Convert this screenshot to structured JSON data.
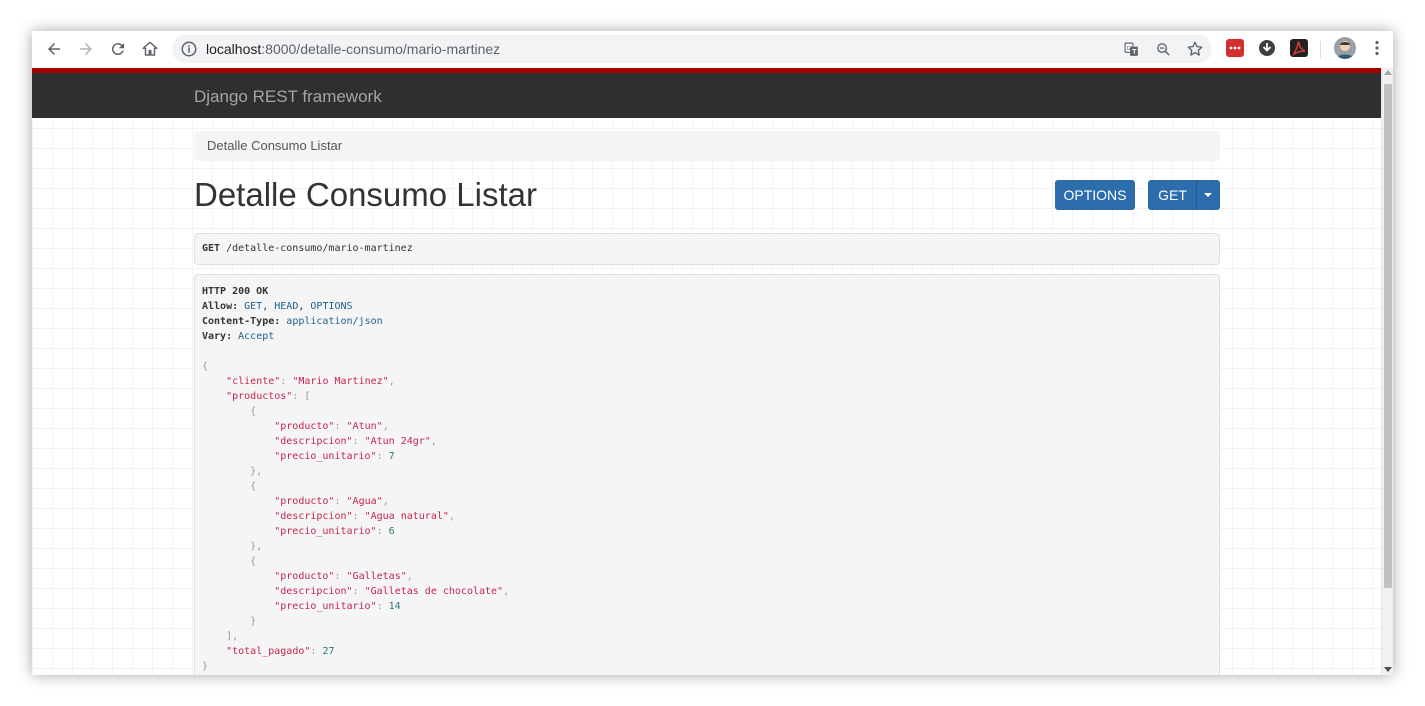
{
  "browser": {
    "url_host": "localhost",
    "url_rest": ":8000/detalle-consumo/mario-martinez"
  },
  "navbar": {
    "brand": "Django REST framework"
  },
  "breadcrumb": {
    "label": "Detalle Consumo Listar"
  },
  "page": {
    "title": "Detalle Consumo Listar"
  },
  "buttons": {
    "options": "OPTIONS",
    "get": "GET"
  },
  "request": {
    "method": "GET",
    "path": " /detalle-consumo/mario-martinez"
  },
  "response": {
    "status": "HTTP 200 OK",
    "allow_label": "Allow:",
    "allow_values": [
      " GET",
      ", ",
      "HEAD",
      ", ",
      "OPTIONS"
    ],
    "content_type_label": "Content-Type:",
    "content_type_value": " application/json",
    "vary_label": "Vary:",
    "vary_value": " Accept"
  },
  "json_body": {
    "cliente": "Mario Martinez",
    "productos": [
      {
        "producto": "Atun",
        "descripcion": "Atun 24gr",
        "precio_unitario": "7"
      },
      {
        "producto": "Agua",
        "descripcion": "Agua natural",
        "precio_unitario": "6"
      },
      {
        "producto": "Galletas",
        "descripcion": "Galletas de chocolate",
        "precio_unitario": "14"
      }
    ],
    "total_pagado": "27"
  },
  "json_keys": {
    "cliente": "\"cliente\"",
    "productos": "\"productos\"",
    "producto": "\"producto\"",
    "descripcion": "\"descripcion\"",
    "precio_unitario": "\"precio_unitario\"",
    "total_pagado": "\"total_pagado\""
  },
  "colors": {
    "navbar": "#2f2f2f",
    "navbar_accent": "#a30000",
    "button": "#2c6ead",
    "json_string": "#c7254e",
    "json_number": "#2b7a78",
    "meta_value": "#1f5f8f"
  },
  "icons": {
    "back": "back-arrow-icon",
    "forward": "forward-arrow-icon",
    "reload": "reload-icon",
    "home": "home-icon",
    "info": "info-icon",
    "translate": "translate-icon",
    "zoom": "zoom-icon",
    "bookmark": "star-icon",
    "extensions": [
      "lastpass-icon",
      "download-icon",
      "acrobat-icon"
    ],
    "profile": "avatar-icon",
    "menu": "kebab-menu-icon"
  }
}
